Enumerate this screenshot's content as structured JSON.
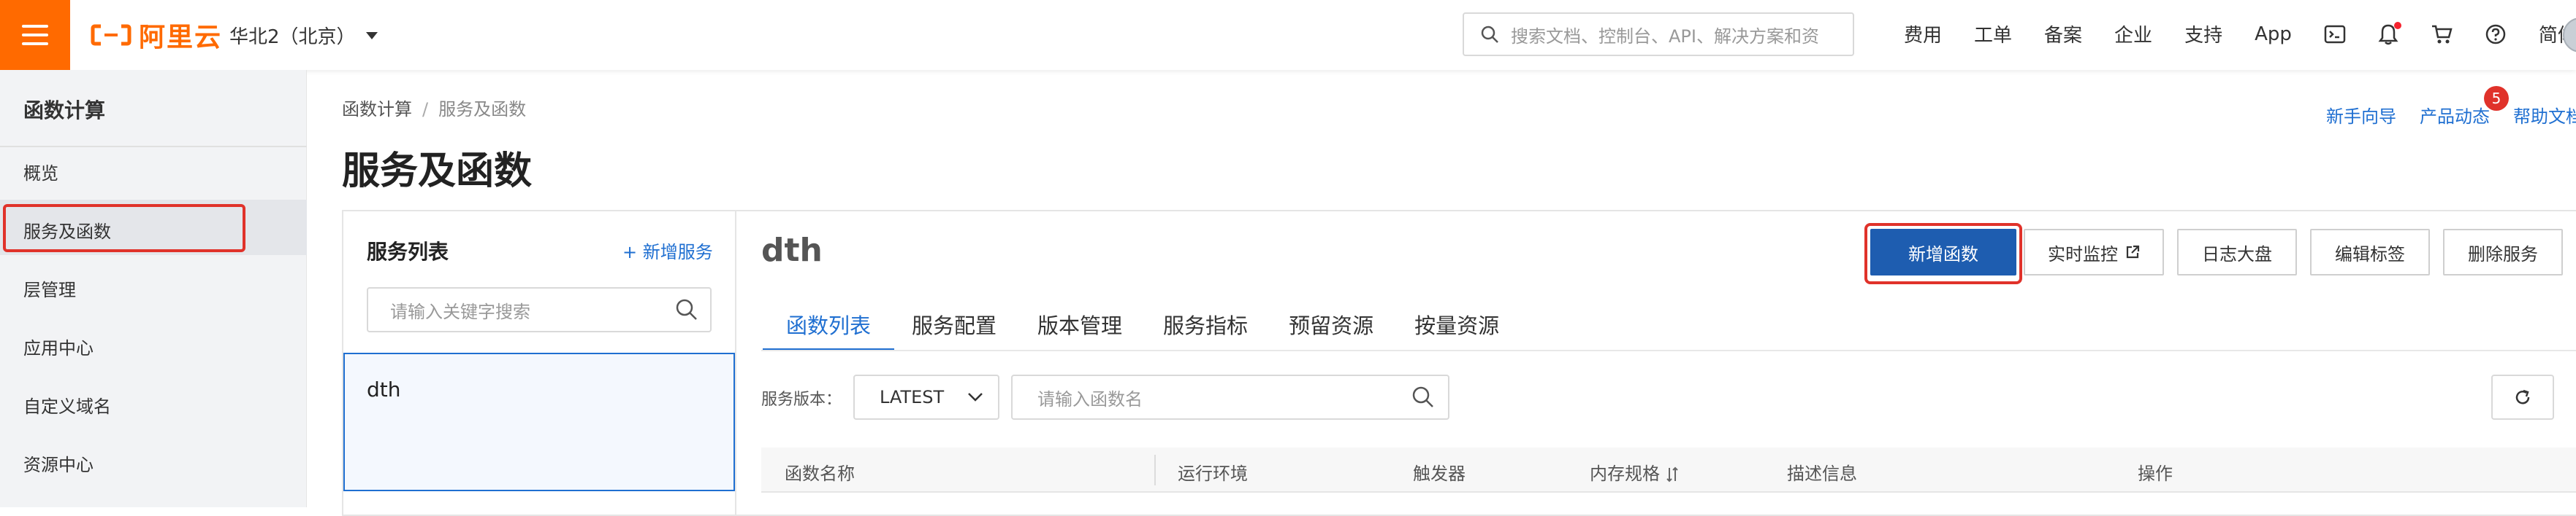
{
  "topbar": {
    "brand": "阿里云",
    "region": "华北2（北京）",
    "search_placeholder": "搜索文档、控制台、API、解决方案和资",
    "nav": [
      "费用",
      "工单",
      "备案",
      "企业",
      "支持",
      "App"
    ],
    "lang": "简体"
  },
  "sidebar": {
    "title": "函数计算",
    "items": [
      "概览",
      "服务及函数",
      "层管理",
      "应用中心",
      "自定义域名",
      "资源中心"
    ]
  },
  "breadcrumb": {
    "root": "函数计算",
    "sep": "/",
    "current": "服务及函数"
  },
  "page_title": "服务及函数",
  "help_links": {
    "guide": "新手向导",
    "news": "产品动态",
    "news_badge": "5",
    "docs": "帮助文档"
  },
  "service_list": {
    "title": "服务列表",
    "add": "+ 新增服务",
    "search_placeholder": "请输入关键字搜索",
    "items": [
      "dth"
    ]
  },
  "service": {
    "name": "dth",
    "buttons": {
      "new_function": "新增函数",
      "monitor": "实时监控",
      "log": "日志大盘",
      "tags": "编辑标签",
      "delete": "删除服务"
    },
    "tabs": [
      "函数列表",
      "服务配置",
      "版本管理",
      "服务指标",
      "预留资源",
      "按量资源"
    ],
    "active_tab": "函数列表",
    "version_label": "服务版本：",
    "version_value": "LATEST",
    "fn_search_placeholder": "请输入函数名",
    "table_headers": [
      "函数名称",
      "运行环境",
      "触发器",
      "内存规格",
      "描述信息",
      "操作"
    ]
  }
}
